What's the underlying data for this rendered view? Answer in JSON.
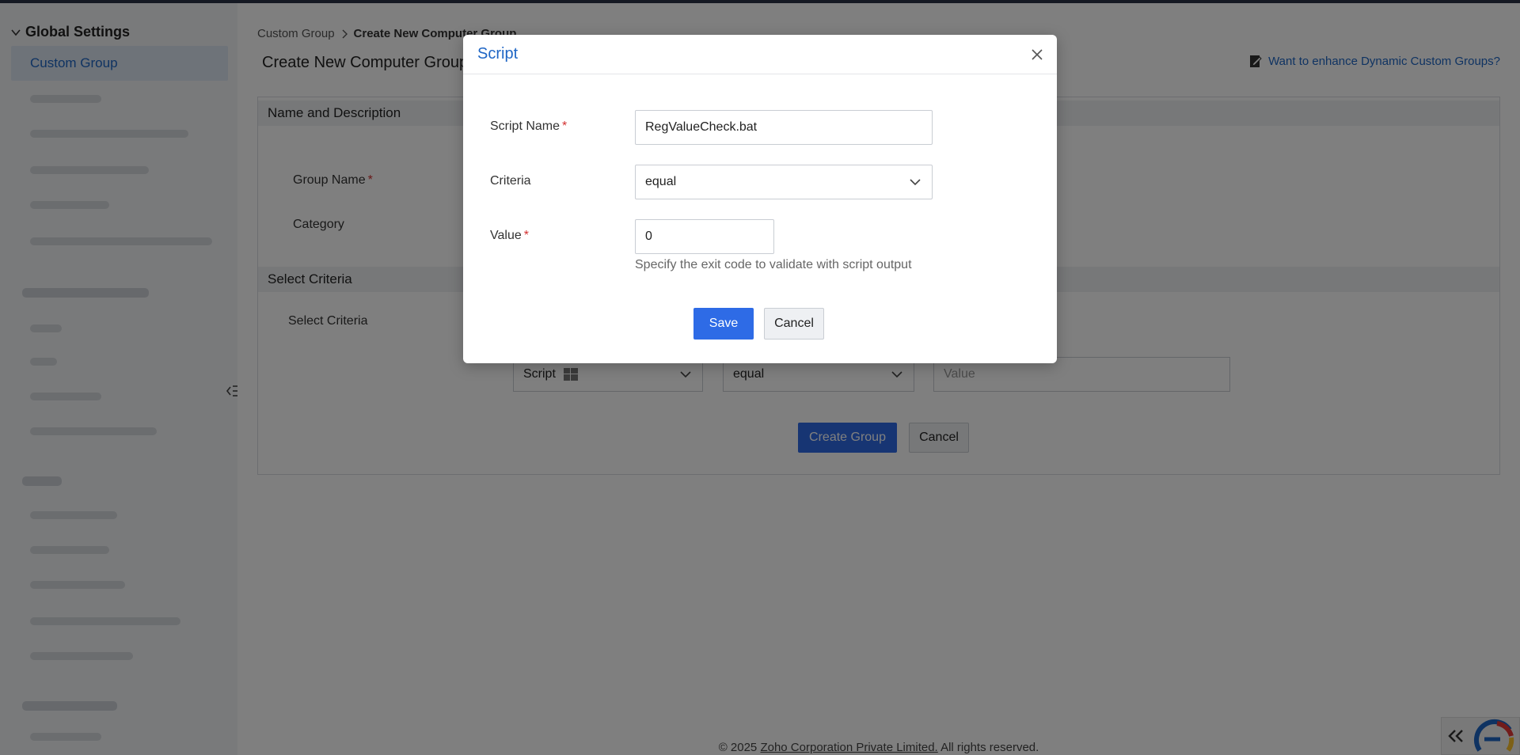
{
  "sidebar": {
    "section_title": "Global Settings",
    "active_item": "Custom Group"
  },
  "breadcrumb": {
    "parent": "Custom Group",
    "current": "Create New Computer Group"
  },
  "page": {
    "title": "Create New Computer Group",
    "enhance_link": "Want to enhance Dynamic Custom Groups?"
  },
  "form": {
    "section_name": "Name and Description",
    "group_name_label": "Group Name",
    "category_label": "Category",
    "section_criteria": "Select Criteria",
    "select_criteria_label": "Select Criteria",
    "criteria_type": "Script",
    "criteria_operator": "equal",
    "value_placeholder": "Value",
    "create_button": "Create Group",
    "cancel_button": "Cancel"
  },
  "footer": {
    "prefix": "© 2025",
    "company": "Zoho Corporation Private Limited.",
    "suffix": "All rights reserved."
  },
  "modal": {
    "title": "Script",
    "script_name_label": "Script Name",
    "script_name_value": "RegValueCheck.bat",
    "criteria_label": "Criteria",
    "criteria_value": "equal",
    "value_label": "Value",
    "value_value": "0",
    "hint": "Specify the exit code to validate with script output",
    "save_label": "Save",
    "cancel_label": "Cancel"
  },
  "colors": {
    "accent": "#1f66c5",
    "primary_button": "#2e6be6",
    "required": "#d32f2f"
  }
}
